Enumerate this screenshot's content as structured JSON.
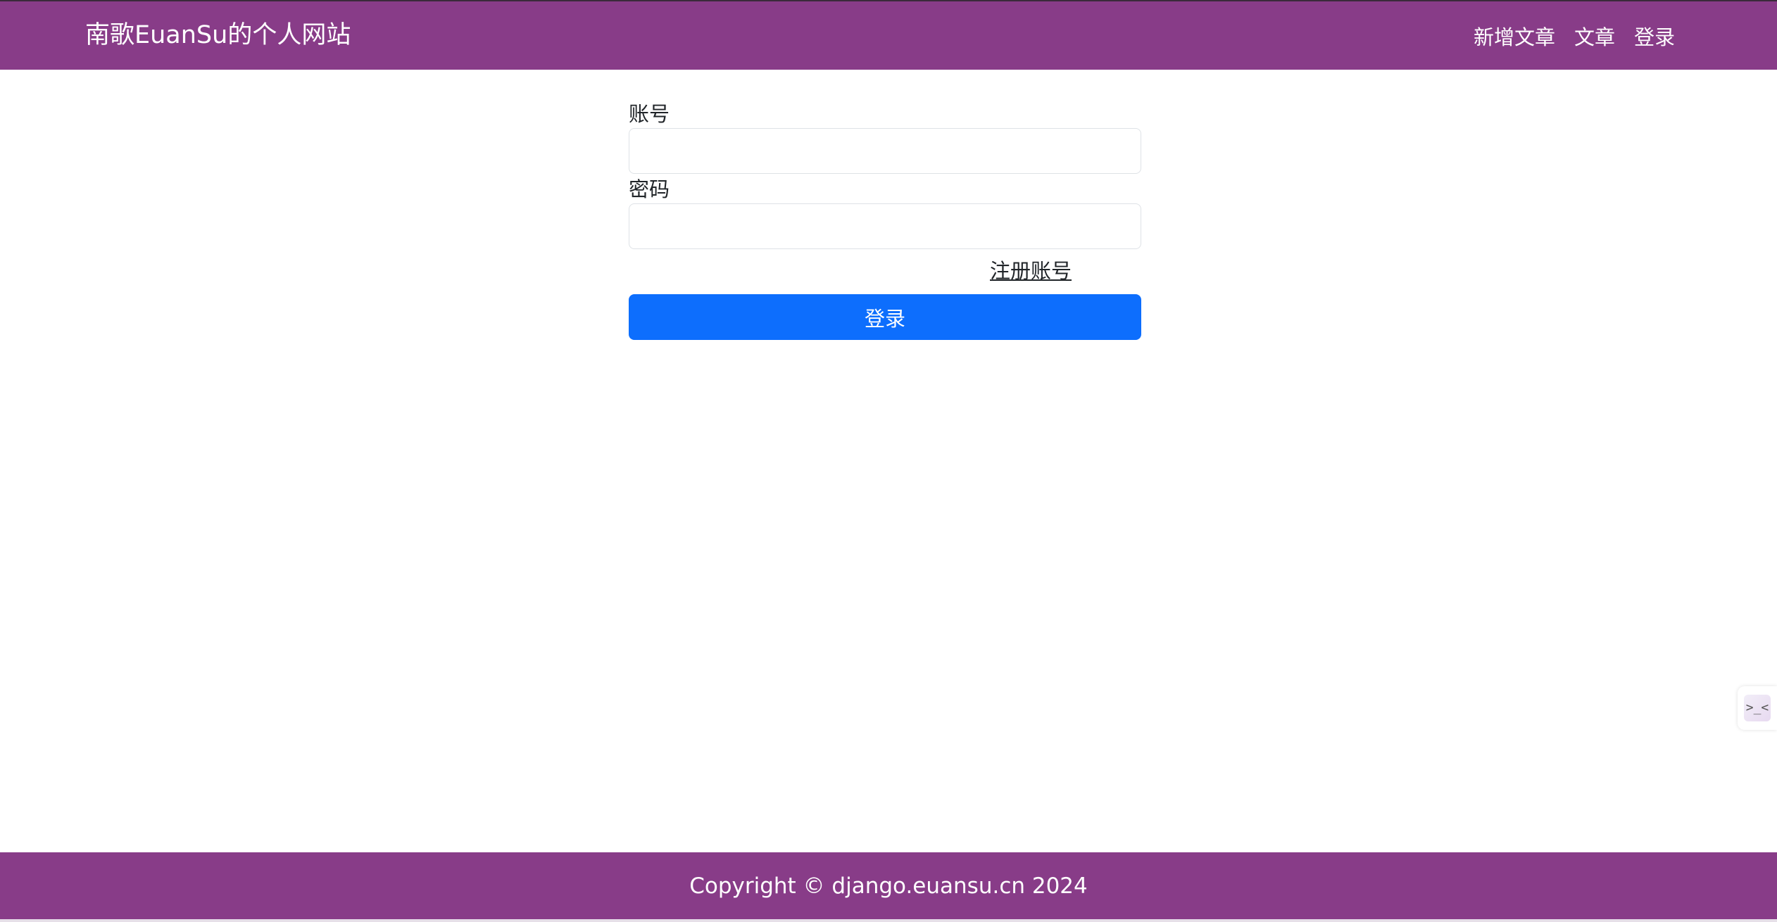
{
  "navbar": {
    "brand": "南歌EuanSu的个人网站",
    "links": [
      "新增文章",
      "文章",
      "登录"
    ],
    "background_color": "#883c88"
  },
  "login_form": {
    "account_label": "账号",
    "account_value": "",
    "password_label": "密码",
    "password_value": "",
    "register_link": "注册账号",
    "submit_label": "登录",
    "submit_color": "#0d6efd"
  },
  "side_widget": {
    "icon": "collapse-code-icon",
    "glyph": ">_<"
  },
  "footer": {
    "text": "Copyright © django.euansu.cn 2024",
    "background_color": "#883c88"
  }
}
